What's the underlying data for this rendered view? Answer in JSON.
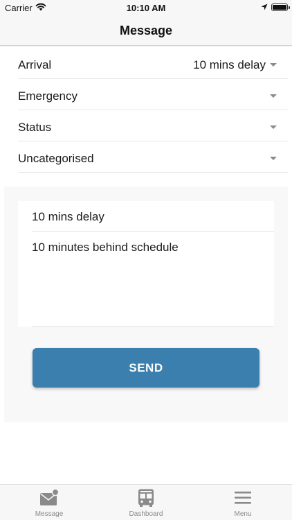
{
  "status_bar": {
    "carrier": "Carrier",
    "time": "10:10 AM",
    "icons": [
      "wifi-icon",
      "location-arrow-icon",
      "battery-icon"
    ]
  },
  "nav": {
    "title": "Message"
  },
  "dropdowns": [
    {
      "label": "Arrival",
      "value": "10 mins delay"
    },
    {
      "label": "Emergency",
      "value": ""
    },
    {
      "label": "Status",
      "value": ""
    },
    {
      "label": "Uncategorised",
      "value": ""
    }
  ],
  "message": {
    "subject": "10 mins delay",
    "body": "10 minutes behind schedule",
    "send_label": "SEND"
  },
  "tabs": [
    {
      "label": "Message",
      "icon": "mail-badge-icon"
    },
    {
      "label": "Dashboard",
      "icon": "bus-icon"
    },
    {
      "label": "Menu",
      "icon": "hamburger-menu-icon"
    }
  ],
  "colors": {
    "accent": "#3b7fae",
    "tab_inactive": "#8a8a8a",
    "bar_background": "#f7f7f7"
  }
}
